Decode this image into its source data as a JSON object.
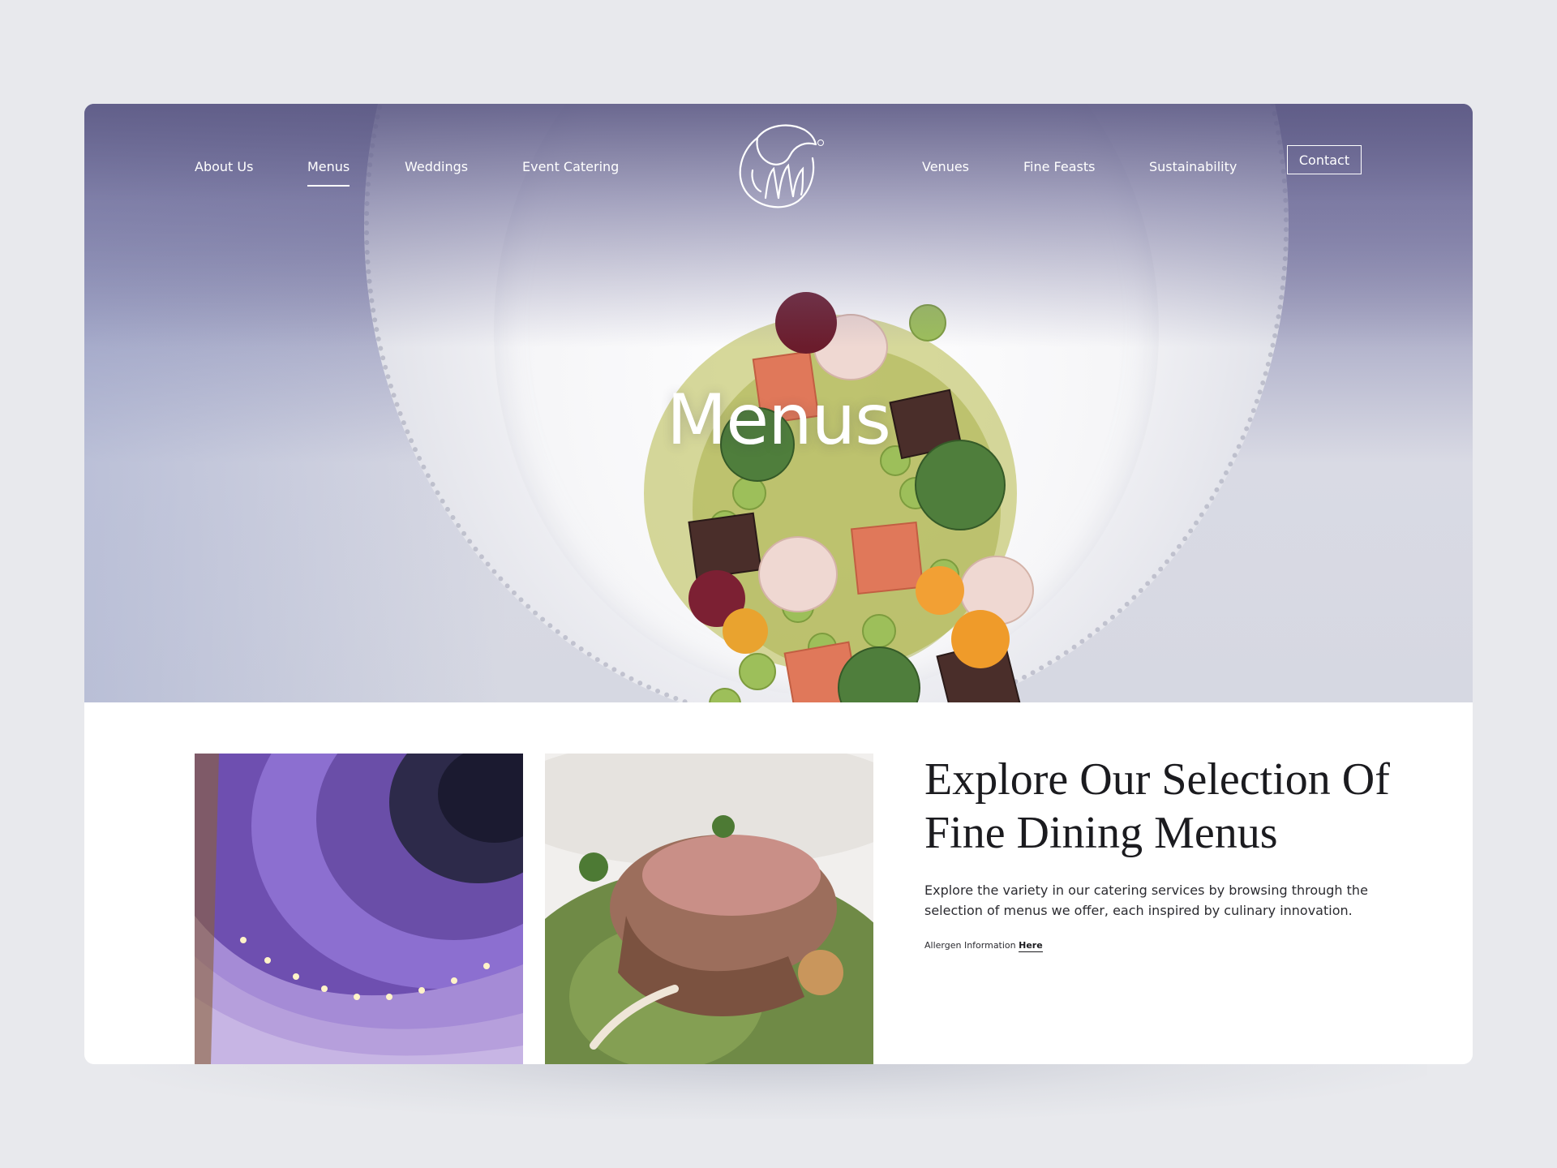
{
  "nav": {
    "left_items": [
      {
        "label": "About Us",
        "active": false
      },
      {
        "label": "Menus",
        "active": true
      },
      {
        "label": "Weddings",
        "active": false
      },
      {
        "label": "Event Catering",
        "active": false
      }
    ],
    "right_items": [
      {
        "label": "Venues",
        "active": false
      },
      {
        "label": "Fine Feasts",
        "active": false
      },
      {
        "label": "Sustainability",
        "active": false
      }
    ],
    "contact_label": "Contact",
    "logo_icon": "swan-hand-logo-icon"
  },
  "hero": {
    "title": "Menus",
    "image_description_icon": "plated-dish-image"
  },
  "intro": {
    "headline": "Explore Our Selection Of Fine Dining Menus",
    "body": "Explore the variety in our catering services by browsing through the selection of menus we offer, each inspired by culinary innovation.",
    "allergen_prefix": "Allergen Information",
    "allergen_link": "Here"
  },
  "colors": {
    "page_bg": "#e8e9ed",
    "hero_top": "#6a6790",
    "text_dark": "#1b1b1f",
    "white": "#ffffff"
  }
}
